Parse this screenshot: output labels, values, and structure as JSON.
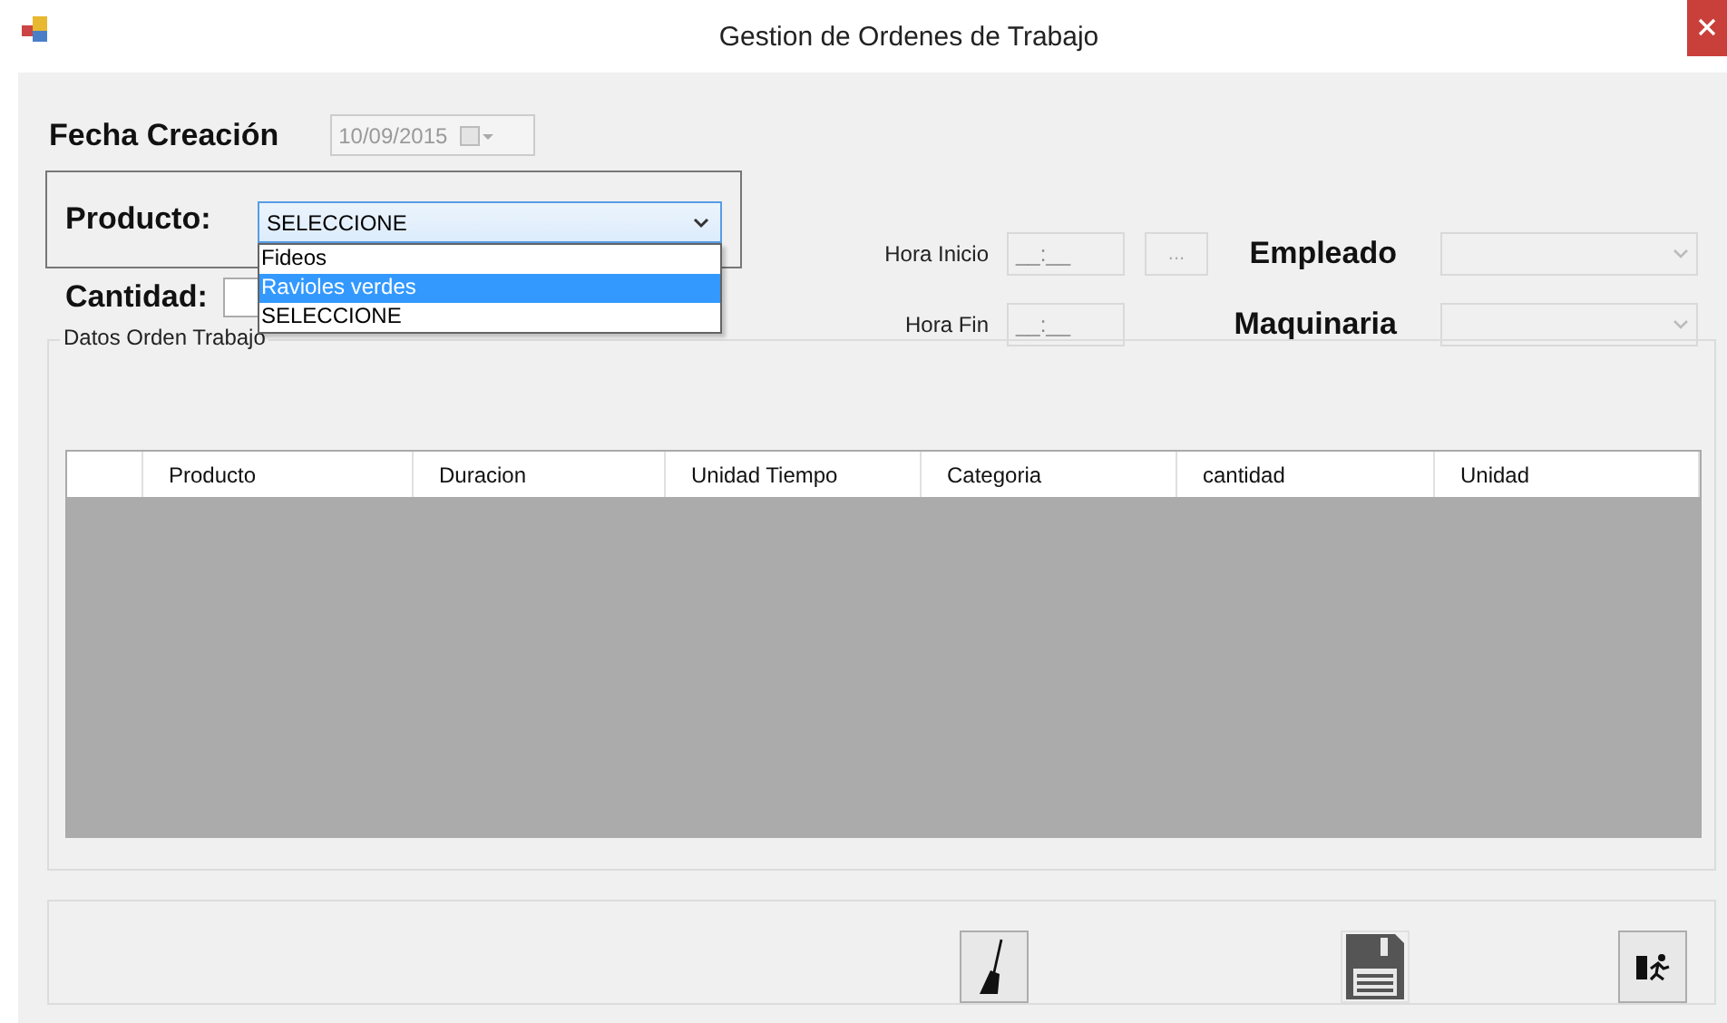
{
  "window": {
    "title": "Gestion de Ordenes de Trabajo"
  },
  "fecha_creacion": {
    "label": "Fecha Creación",
    "value": "10/09/2015",
    "disabled": true
  },
  "producto": {
    "label": "Producto:",
    "value": "SELECCIONE",
    "expanded": true,
    "options": [
      {
        "label": "Fideos",
        "highlighted": false
      },
      {
        "label": "Ravioles verdes",
        "highlighted": true
      },
      {
        "label": "SELECCIONE",
        "highlighted": false
      }
    ]
  },
  "cantidad": {
    "label": "Cantidad:"
  },
  "hora_inicio": {
    "label": "Hora Inicio",
    "value": "__:__",
    "button": "...",
    "disabled": true
  },
  "hora_fin": {
    "label": "Hora Fin",
    "value": "__:__",
    "disabled": true
  },
  "empleado": {
    "label": "Empleado",
    "disabled": true
  },
  "maquinaria": {
    "label": "Maquinaria",
    "disabled": true
  },
  "datos_orden": {
    "title": "Datos Orden Trabajo",
    "columns": [
      "Producto",
      "Duracion",
      "Unidad Tiempo",
      "Categoria",
      "cantidad",
      "Unidad"
    ]
  },
  "buttons": [
    {
      "kind": "clear"
    },
    {
      "kind": "save"
    },
    {
      "kind": "exit"
    }
  ]
}
